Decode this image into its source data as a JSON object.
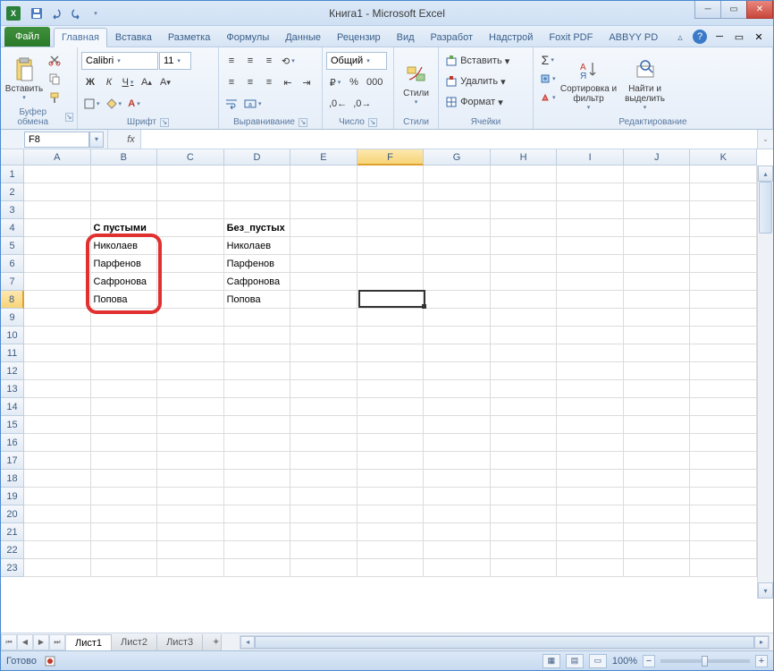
{
  "title": "Книга1  -  Microsoft Excel",
  "qat": {
    "save": "💾",
    "undo": "↶",
    "redo": "↷"
  },
  "tabs": {
    "file": "Файл",
    "items": [
      "Главная",
      "Вставка",
      "Разметка",
      "Формулы",
      "Данные",
      "Рецензир",
      "Вид",
      "Разработ",
      "Надстрой",
      "Foxit PDF",
      "ABBYY PD"
    ],
    "active": 0
  },
  "ribbon": {
    "clipboard": {
      "paste": "Вставить",
      "label": "Буфер обмена"
    },
    "font": {
      "name": "Calibri",
      "size": "11",
      "b": "Ж",
      "i": "К",
      "u": "Ч",
      "label": "Шрифт"
    },
    "align": {
      "label": "Выравнивание"
    },
    "number": {
      "fmt": "Общий",
      "label": "Число"
    },
    "styles": {
      "btn": "Стили",
      "label": "Стили"
    },
    "cells": {
      "insert": "Вставить",
      "delete": "Удалить",
      "format": "Формат",
      "label": "Ячейки"
    },
    "editing": {
      "sort": "Сортировка и фильтр",
      "find": "Найти и выделить",
      "label": "Редактирование"
    }
  },
  "namebox": "F8",
  "fx_label": "fx",
  "columns": [
    "A",
    "B",
    "C",
    "D",
    "E",
    "F",
    "G",
    "H",
    "I",
    "J",
    "K"
  ],
  "sel_col": "F",
  "rows": [
    1,
    2,
    3,
    4,
    5,
    6,
    7,
    8,
    9,
    10,
    11,
    12,
    13,
    14,
    15,
    16,
    17,
    18,
    19,
    20,
    21,
    22,
    23
  ],
  "sel_row": 8,
  "cells": {
    "B4": "С пустыми",
    "D4": "Без_пустых",
    "B5": "Николаев",
    "D5": "Николаев",
    "B6": "Парфенов",
    "D6": "Парфенов",
    "B7": "Сафронова",
    "D7": "Сафронова",
    "B8": "Попова",
    "D8": "Попова"
  },
  "sheets": [
    "Лист1",
    "Лист2",
    "Лист3"
  ],
  "active_sheet": 0,
  "status": "Готово",
  "zoom": "100%"
}
